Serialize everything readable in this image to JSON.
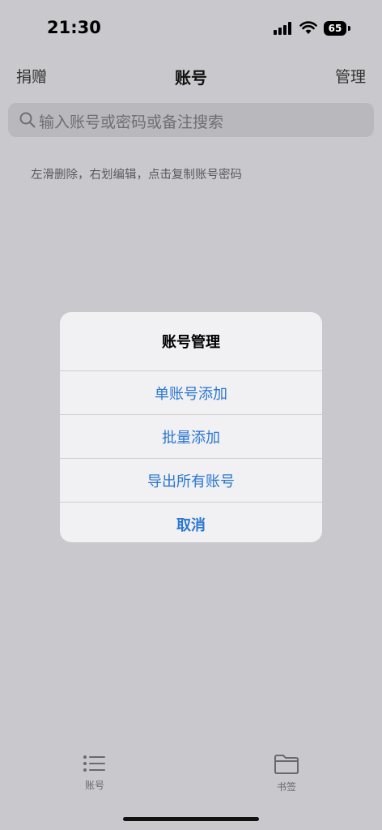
{
  "status": {
    "time": "21:30",
    "battery": "65"
  },
  "nav": {
    "left": "捐赠",
    "title": "账号",
    "right": "管理"
  },
  "search": {
    "placeholder": "输入账号或密码或备注搜索"
  },
  "hint": "左滑删除，右划编辑，点击复制账号密码",
  "dialog": {
    "title": "账号管理",
    "options": [
      "单账号添加",
      "批量添加",
      "导出所有账号"
    ],
    "cancel": "取消"
  },
  "tabs": [
    {
      "label": "账号",
      "icon": "list-icon"
    },
    {
      "label": "书签",
      "icon": "folder-icon"
    }
  ],
  "colors": {
    "accent": "#2a76d2",
    "overlay_bg": "#c9c8cd",
    "dialog_bg": "#f1f1f3"
  }
}
